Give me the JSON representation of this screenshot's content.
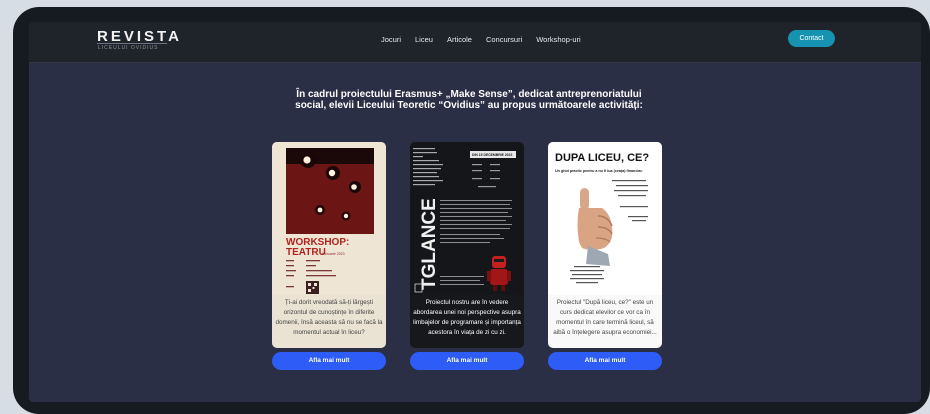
{
  "header": {
    "logo": "REVISTA",
    "logo_tagline": "LICEULUI OVIDIUS",
    "nav": [
      "Jocuri",
      "Liceu",
      "Articole",
      "Concursuri",
      "Workshop-uri"
    ],
    "contact_label": "Contact"
  },
  "intro": "În cadrul proiectului Erasmus+ „Make Sense”, dedicat antreprenoriatului\nsocial, elevii Liceului Teoretic “Ovidius” au propus următoarele activități:",
  "cards": [
    {
      "poster_title": "WORKSHOP:",
      "poster_subtitle": "TEATRU",
      "poster_date": "februarie 2023",
      "excerpt": "Ți-ai dorit vreodată să-ți lărgești orizontul de cunoștințe în diferite domenii, însă aceasta să nu se facă la momentul actual în liceu?",
      "button": "Afla mai mult"
    },
    {
      "poster_title": "TGLANCE",
      "poster_date": "DIN 15 DECEMBRIE 2022",
      "excerpt": "Proiectul nostru are în vedere abordarea unei noi perspective asupra limbajelor de programare și importanța acestora în viața de zi cu zi.",
      "button": "Afla mai mult"
    },
    {
      "poster_title": "DUPA LICEU, CE?",
      "poster_subtitle": "Un ghid practic pentru a nu fi lua (ceața) financiar.",
      "excerpt": "Proiectul \"După liceu, ce?\" este un curs dedicat elevilor ce vor ca în momentul în care termină liceul, să aibă o înțelegere asupra economiei...",
      "button": "Afla mai mult"
    }
  ],
  "colors": {
    "page_background": "#d6dde5",
    "screen": "#2a2f45",
    "navbar": "#1f232a",
    "contact": "#1793b2",
    "button": "#2d5cf6"
  },
  "icons": [
    "qr-code-icon",
    "thumbs-up-icon",
    "robot-icon"
  ]
}
